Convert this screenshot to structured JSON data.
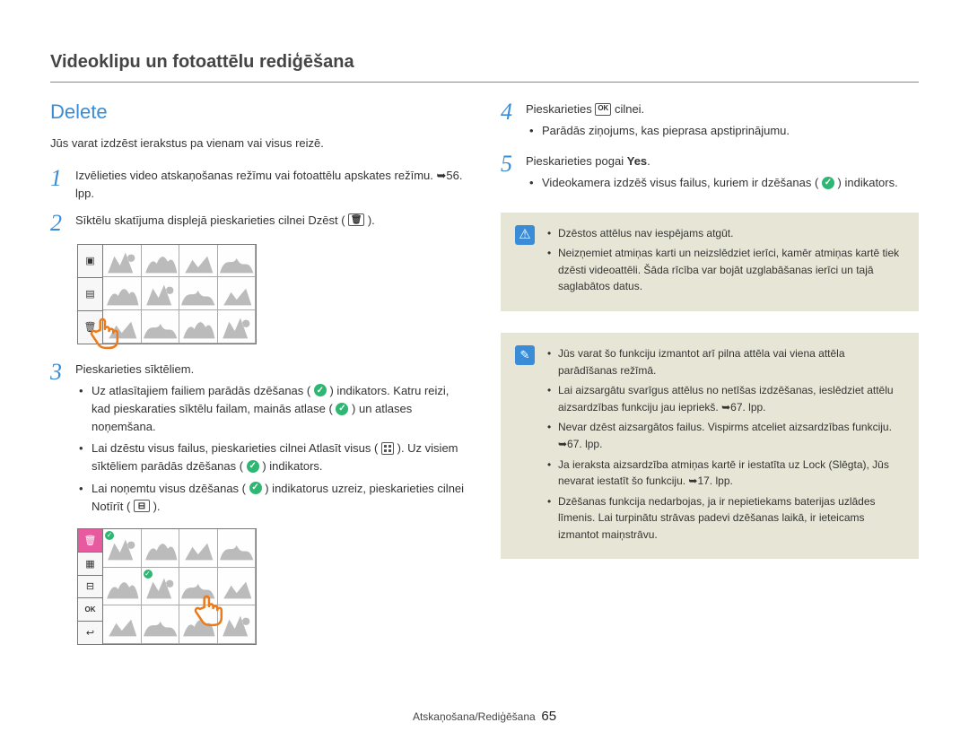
{
  "page_title": "Videoklipu un fotoattēlu rediģēšana",
  "section_title": "Delete",
  "intro": "Jūs varat izdzēst ierakstus pa vienam vai visus reizē.",
  "steps": {
    "s1": "Izvēlieties video atskaņošanas režīmu vai fotoattēlu apskates režīmu. ➥56. lpp.",
    "s2_a": "Sīktēlu skatījuma displejā pieskarieties cilnei Dzēst (",
    "s2_b": ").",
    "s3_main": "Pieskarieties sīktēliem.",
    "s3_b1_a": "Uz atlasītajiem failiem parādās dzēšanas (",
    "s3_b1_b": ") indikators. Katru reizi, kad pieskaraties sīktēlu failam, mainās atlase (",
    "s3_b1_c": ") un atlases noņemšana.",
    "s3_b2_a": "Lai dzēstu visus failus, pieskarieties cilnei Atlasīt visus (",
    "s3_b2_b": "). Uz visiem sīktēliem parādās dzēšanas (",
    "s3_b2_c": ") indikators.",
    "s3_b3_a": "Lai noņemtu visus dzēšanas (",
    "s3_b3_b": ") indikatorus uzreiz, pieskarieties cilnei Notīrīt (",
    "s3_b3_c": ").",
    "s4_a": "Pieskarieties ",
    "s4_b": " cilnei.",
    "s4_bul": "Parādās ziņojums, kas pieprasa apstiprinājumu.",
    "s5_a": "Pieskarieties pogai ",
    "s5_bold": "Yes",
    "s5_b": ".",
    "s5_bul_a": "Videokamera izdzēš visus failus, kuriem ir dzēšanas (",
    "s5_bul_b": ") indikators."
  },
  "warn_box": {
    "b1": "Dzēstos attēlus nav iespējams atgūt.",
    "b2": "Neizņemiet atmiņas karti un neizslēdziet ierīci, kamēr atmiņas kartē tiek dzēsti videoattēli. Šāda rīcība var bojāt uzglabāšanas ierīci un tajā saglabātos datus."
  },
  "note_box": {
    "b1": "Jūs varat šo funkciju izmantot arī pilna attēla vai viena attēla parādīšanas režīmā.",
    "b2": "Lai aizsargātu svarīgus attēlus no netīšas izdzēšanas, ieslēdziet attēlu aizsardzības funkciju jau iepriekš. ➥67. lpp.",
    "b3": "Nevar dzēst aizsargātos failus. Vispirms atceliet aizsardzības funkciju. ➥67. lpp.",
    "b4": "Ja ieraksta aizsardzība atmiņas kartē ir iestatīta uz Lock (Slēgta), Jūs nevarat iestatīt šo funkciju. ➥17. lpp.",
    "b5": "Dzēšanas funkcija nedarbojas, ja ir nepietiekams baterijas uzlādes līmenis. Lai turpinātu strāvas padevi dzēšanas laikā, ir ieteicams izmantot maiņstrāvu."
  },
  "footer": {
    "text": "Atskaņošana/Rediģēšana",
    "page": "65"
  },
  "icons": {
    "ok": "OK"
  }
}
